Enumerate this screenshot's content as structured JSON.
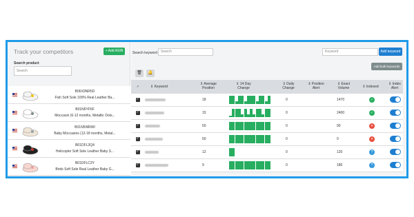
{
  "left_panel": {
    "title": "Track your competitors",
    "add_asin_label": "+ Add ASIN",
    "search_label": "Search product",
    "search_placeholder": "Search",
    "products": [
      {
        "asin": "B06X9NR5D",
        "name": "Fish Soft Sole 100% Real Leather Ba..."
      },
      {
        "asin": "B01N6YF6F",
        "name": "Moccasin (6-12 months, Metallic Dots..."
      },
      {
        "asin": "B01N5WRWI",
        "name": "Baby Moccasins (12-18 months, Metal..."
      },
      {
        "asin": "B01DFL3Q4",
        "name": "Helicopter Soft Sole Leather Baby S..."
      },
      {
        "asin": "B01DFLC3Y",
        "name": "Birds Soft Sole Real Leather Baby G..."
      }
    ]
  },
  "right_panel": {
    "search_keyword_label": "Search keyword",
    "search_keyword_placeholder": "Search",
    "keyword_placeholder": "Keyword",
    "add_keyword_label": "Add keyword",
    "add_bulk_label": "Add bulk keywords",
    "toolbar_icons": [
      "trash-icon",
      "bell-icon"
    ],
    "columns": {
      "check": "✓",
      "keyword": "⇕ Keyword",
      "avg_position": "⇕ Average Position",
      "trend": "⇕ 14 Day Change",
      "daily_change": "⇕ Daily Change",
      "position_alert": "⇕ Position Alert",
      "exact_volume": "⇕ Exact Volume",
      "indexed": "⇕ Indexed",
      "index_alert": "⇕ Index Alert"
    },
    "rows": [
      {
        "avg_position": "18",
        "daily_change": "0",
        "exact_volume": "1470",
        "indexed": "yes",
        "trend": [
          1,
          1,
          0.3,
          1,
          1,
          0.3,
          1,
          1,
          1,
          0.3,
          1,
          1,
          0.3,
          1
        ]
      },
      {
        "avg_position": "15",
        "daily_change": "0",
        "exact_volume": "2400",
        "indexed": "yes",
        "trend": [
          0.2,
          1,
          1,
          1,
          0.3,
          1,
          0.3,
          1,
          0.3,
          1,
          1,
          0.3,
          1,
          1
        ]
      },
      {
        "avg_position": "50",
        "daily_change": "0",
        "exact_volume": "90",
        "indexed": "no",
        "trend": [
          1,
          1,
          1,
          1,
          1,
          1,
          1,
          1,
          1,
          1,
          1,
          1,
          1,
          1
        ]
      },
      {
        "avg_position": "50",
        "daily_change": "0",
        "exact_volume": "0",
        "indexed": "no",
        "trend": [
          1,
          1,
          1,
          1,
          1,
          1,
          1,
          1,
          1,
          1,
          1,
          1,
          1,
          1
        ]
      },
      {
        "avg_position": "12",
        "daily_change": "0",
        "exact_volume": "120",
        "indexed": "pending",
        "trend": [
          1,
          1
        ]
      },
      {
        "avg_position": "9",
        "daily_change": "0",
        "exact_volume": "180",
        "indexed": "pending",
        "trend": [
          1,
          1,
          1,
          1,
          1,
          1,
          1,
          1,
          1,
          1,
          1,
          1,
          1,
          1
        ]
      }
    ]
  },
  "colors": {
    "frame": "#1e9be9",
    "green": "#27ae60",
    "blue": "#1e7fd1",
    "red": "#e74c3c",
    "status_blue": "#3498db"
  }
}
